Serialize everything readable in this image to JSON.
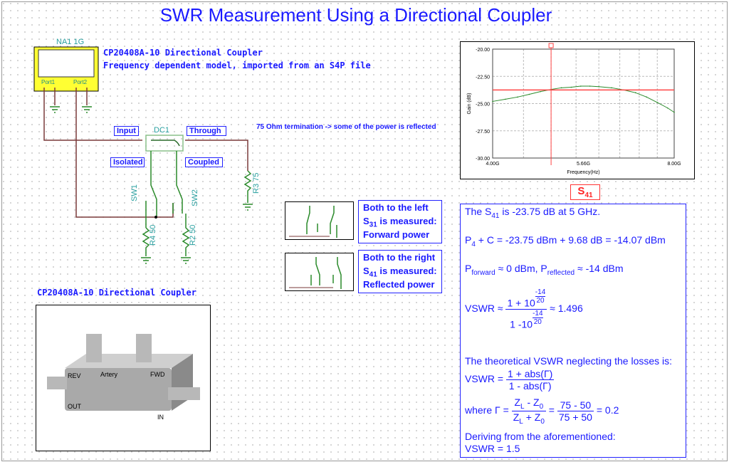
{
  "title": "SWR Measurement Using a Directional Coupler",
  "schematic": {
    "na_label": "NA1 1G",
    "port1": "Port1",
    "port2": "Port2",
    "desc_line1": "CP20408A-10 Directional Coupler",
    "desc_line2": "Frequency dependent model, imported from an S4P file",
    "dc_label": "DC1",
    "input": "Input",
    "through": "Through",
    "isolated": "Isolated",
    "coupled": "Coupled",
    "termination_note": "75 Ohm termination -> some of the power is reflected",
    "sw1": "SW1",
    "sw2": "SW2",
    "r4": "R4 50",
    "r2": "R2 50",
    "r3": "R3 75"
  },
  "photo": {
    "caption": "CP20408A-10 Directional Coupler",
    "rev": "REV",
    "fwd": "FWD",
    "out": "OUT",
    "in": "IN",
    "brand": "Artery"
  },
  "cases": [
    {
      "line1": "Both to the left",
      "s": "S",
      "sub": "31",
      "line2": " is measured:",
      "line3": "Forward power"
    },
    {
      "line1": "Both to the right",
      "s": "S",
      "sub": "41",
      "line2": " is measured:",
      "line3": "Reflected power"
    }
  ],
  "chart_label": {
    "s": "S",
    "sub": "41"
  },
  "chart_data": {
    "type": "line",
    "xlabel": "Frequency(Hz)",
    "ylabel": "Gain (dB)",
    "xscale": "log",
    "xlim": [
      4000000000.0,
      8000000000.0
    ],
    "ylim": [
      -30,
      -20
    ],
    "xticks": [
      "4.00G",
      "5.66G",
      "8.00G"
    ],
    "yticks": [
      "-20.00",
      "-22.50",
      "-25.00",
      "-27.50",
      "-30.00"
    ],
    "grid": true,
    "series": [
      {
        "color": "#2a8a2a",
        "x": [
          4.0,
          4.2,
          4.4,
          4.6,
          4.8,
          5.0,
          5.2,
          5.4,
          5.6,
          5.8,
          6.0,
          6.3,
          6.6,
          6.9,
          7.2,
          7.5,
          7.8,
          8.0
        ],
        "y": [
          -24.8,
          -24.6,
          -24.4,
          -24.15,
          -23.9,
          -23.7,
          -23.55,
          -23.5,
          -23.4,
          -23.4,
          -23.45,
          -23.55,
          -23.75,
          -24.0,
          -24.4,
          -24.9,
          -25.4,
          -25.8
        ]
      }
    ],
    "cursor_x": 5.0,
    "cursor_y": -23.75,
    "cursor_color": "#ff4444"
  },
  "calc": {
    "l1a": "The S",
    "l1sub": "41",
    "l1b": " is -23.75 dB at 5 GHz.",
    "l2a": "P",
    "l2sub": "4",
    "l2b": " + C = -23.75 dBm + 9.68 dB = -14.07 dBm",
    "l3a": "P",
    "l3sub1": "forward",
    "l3b": " ≈ 0 dBm, P",
    "l3sub2": "reflected",
    "l3c": " ≈ -14 dBm",
    "vswr": "VSWR ≈",
    "num": "1 + 10",
    "den": "1 -10",
    "exp_n": "-14",
    "exp_d": "20",
    "result1": "≈ 1.496",
    "theory": "The theoretical VSWR neglecting the losses is:",
    "vswr2": "VSWR =",
    "num2": "1 + abs(Γ)",
    "den2": "1 - abs(Γ)",
    "where": "where Γ =",
    "zl": "Z",
    "zsubL": "L",
    "minus": " - Z",
    "zsub0": "0",
    "plus": " + Z",
    "eq": "=",
    "num3": "75 - 50",
    "den3": "75 + 50",
    "res3": "= 0.2",
    "deriving": "Deriving from the aforementioned:",
    "final": "VSWR = 1.5"
  }
}
